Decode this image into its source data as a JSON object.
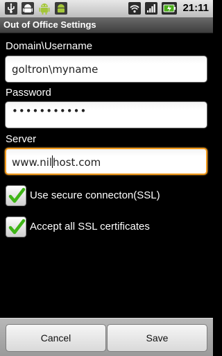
{
  "status_bar": {
    "left_icons": [
      "usb-icon",
      "android-icon",
      "android-debug-icon",
      "android-icon"
    ],
    "right_icons": [
      "wifi-icon",
      "signal-icon",
      "battery-charging-icon"
    ],
    "time": "21:11"
  },
  "title": "Out of Office Settings",
  "form": {
    "username_label": "Domain\\Username",
    "username_value": "goltron\\myname",
    "password_label": "Password",
    "password_value": "•••••••••••",
    "server_label": "Server",
    "server_value_before_cursor": "www.nil",
    "server_value_after_cursor": "host.com",
    "ssl_label": "Use secure connecton(SSL)",
    "ssl_checked": true,
    "accept_certs_label": "Accept all SSL certificates",
    "accept_certs_checked": true
  },
  "buttons": {
    "cancel": "Cancel",
    "save": "Save"
  },
  "colors": {
    "focus_border": "#f29a1c",
    "check_green": "#3fb517",
    "android_green": "#a4c639"
  }
}
